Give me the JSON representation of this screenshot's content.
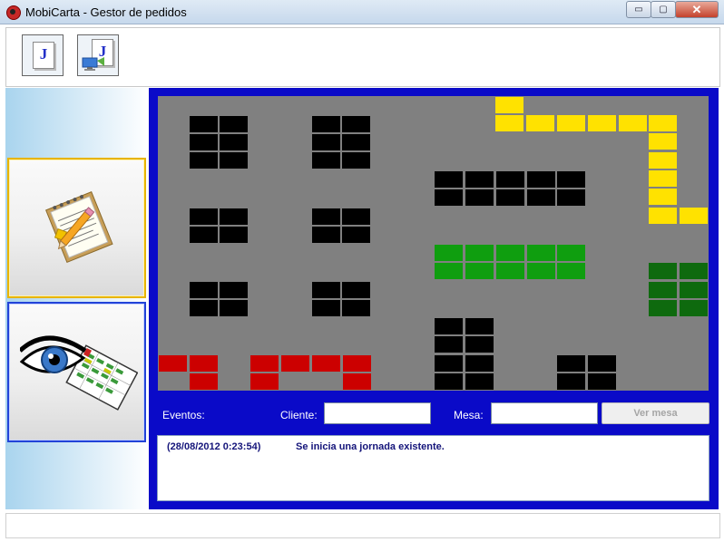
{
  "window": {
    "title": "MobiCarta - Gestor de pedidos",
    "controls": {
      "minimize": "▭",
      "maximize": "▢",
      "close": "✕"
    }
  },
  "toolbar": {
    "buttons": [
      {
        "icon": "jornada-icon",
        "glyph": "J"
      },
      {
        "icon": "jornada-network-icon",
        "glyph": "J"
      }
    ]
  },
  "sidebar": {
    "items": [
      {
        "icon": "notepad-pencil-icon",
        "selected": true,
        "accent": "#e7b400"
      },
      {
        "icon": "eye-table-map-icon",
        "selected": false,
        "accent": "#2243d8"
      }
    ]
  },
  "floor": {
    "background": "#808080",
    "frame_color": "#0a0ac8",
    "colors": {
      "black": "#000000",
      "yellow": "#ffe200",
      "green": "#0f9e0f",
      "darkgreen": "#0e6a0e",
      "red": "#cc0000"
    }
  },
  "controls": {
    "eventos_label": "Eventos:",
    "cliente_label": "Cliente:",
    "cliente_value": "",
    "mesa_label": "Mesa:",
    "mesa_value": "",
    "ver_mesa_label": "Ver mesa"
  },
  "log": {
    "entries": [
      {
        "time": "(28/08/2012 0:23:54)",
        "message": "Se inicia una jornada existente."
      }
    ]
  }
}
